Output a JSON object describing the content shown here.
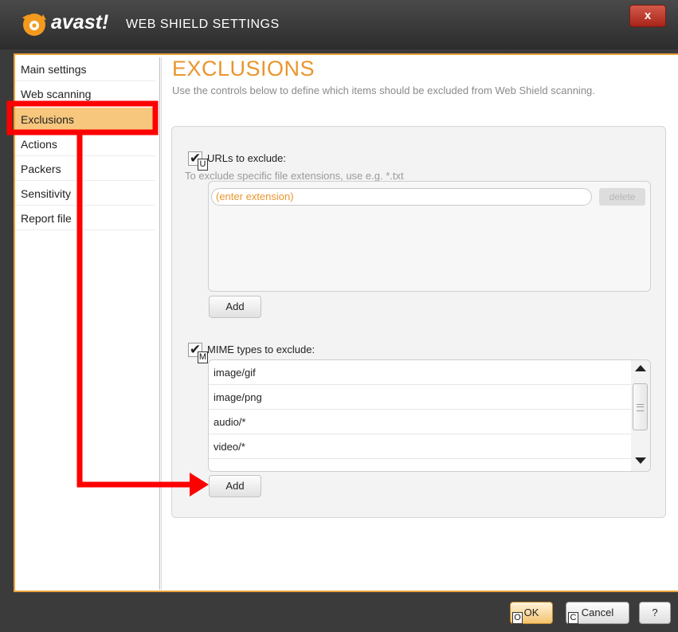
{
  "window": {
    "brand": "avast!",
    "title": "WEB SHIELD SETTINGS",
    "close_label": "x"
  },
  "sidebar": {
    "items": [
      {
        "label": "Main settings"
      },
      {
        "label": "Web scanning"
      },
      {
        "label": "Exclusions",
        "active": true
      },
      {
        "label": "Actions"
      },
      {
        "label": "Packers"
      },
      {
        "label": "Sensitivity"
      },
      {
        "label": "Report file"
      }
    ]
  },
  "main": {
    "title": "EXCLUSIONS",
    "description": "Use the controls below to define which items should be excluded from Web Shield scanning.",
    "urls": {
      "checked": true,
      "hotkey": "U",
      "label": "URLs to exclude:",
      "hint": "To exclude specific file extensions, use e.g. *.txt",
      "input_placeholder": "(enter extension)",
      "delete_label": "delete",
      "add_label": "Add"
    },
    "mime": {
      "checked": true,
      "hotkey": "M",
      "label": "MIME types to exclude:",
      "items": [
        "image/gif",
        "image/png",
        "audio/*",
        "video/*"
      ],
      "add_label": "Add"
    }
  },
  "footer": {
    "ok_label": "OK",
    "ok_hotkey": "O",
    "cancel_label": "Cancel",
    "cancel_hotkey": "C",
    "help_label": "?"
  },
  "colors": {
    "accent": "#e9962e",
    "active_item": "#f7c77d",
    "annotation": "#ff0000"
  }
}
